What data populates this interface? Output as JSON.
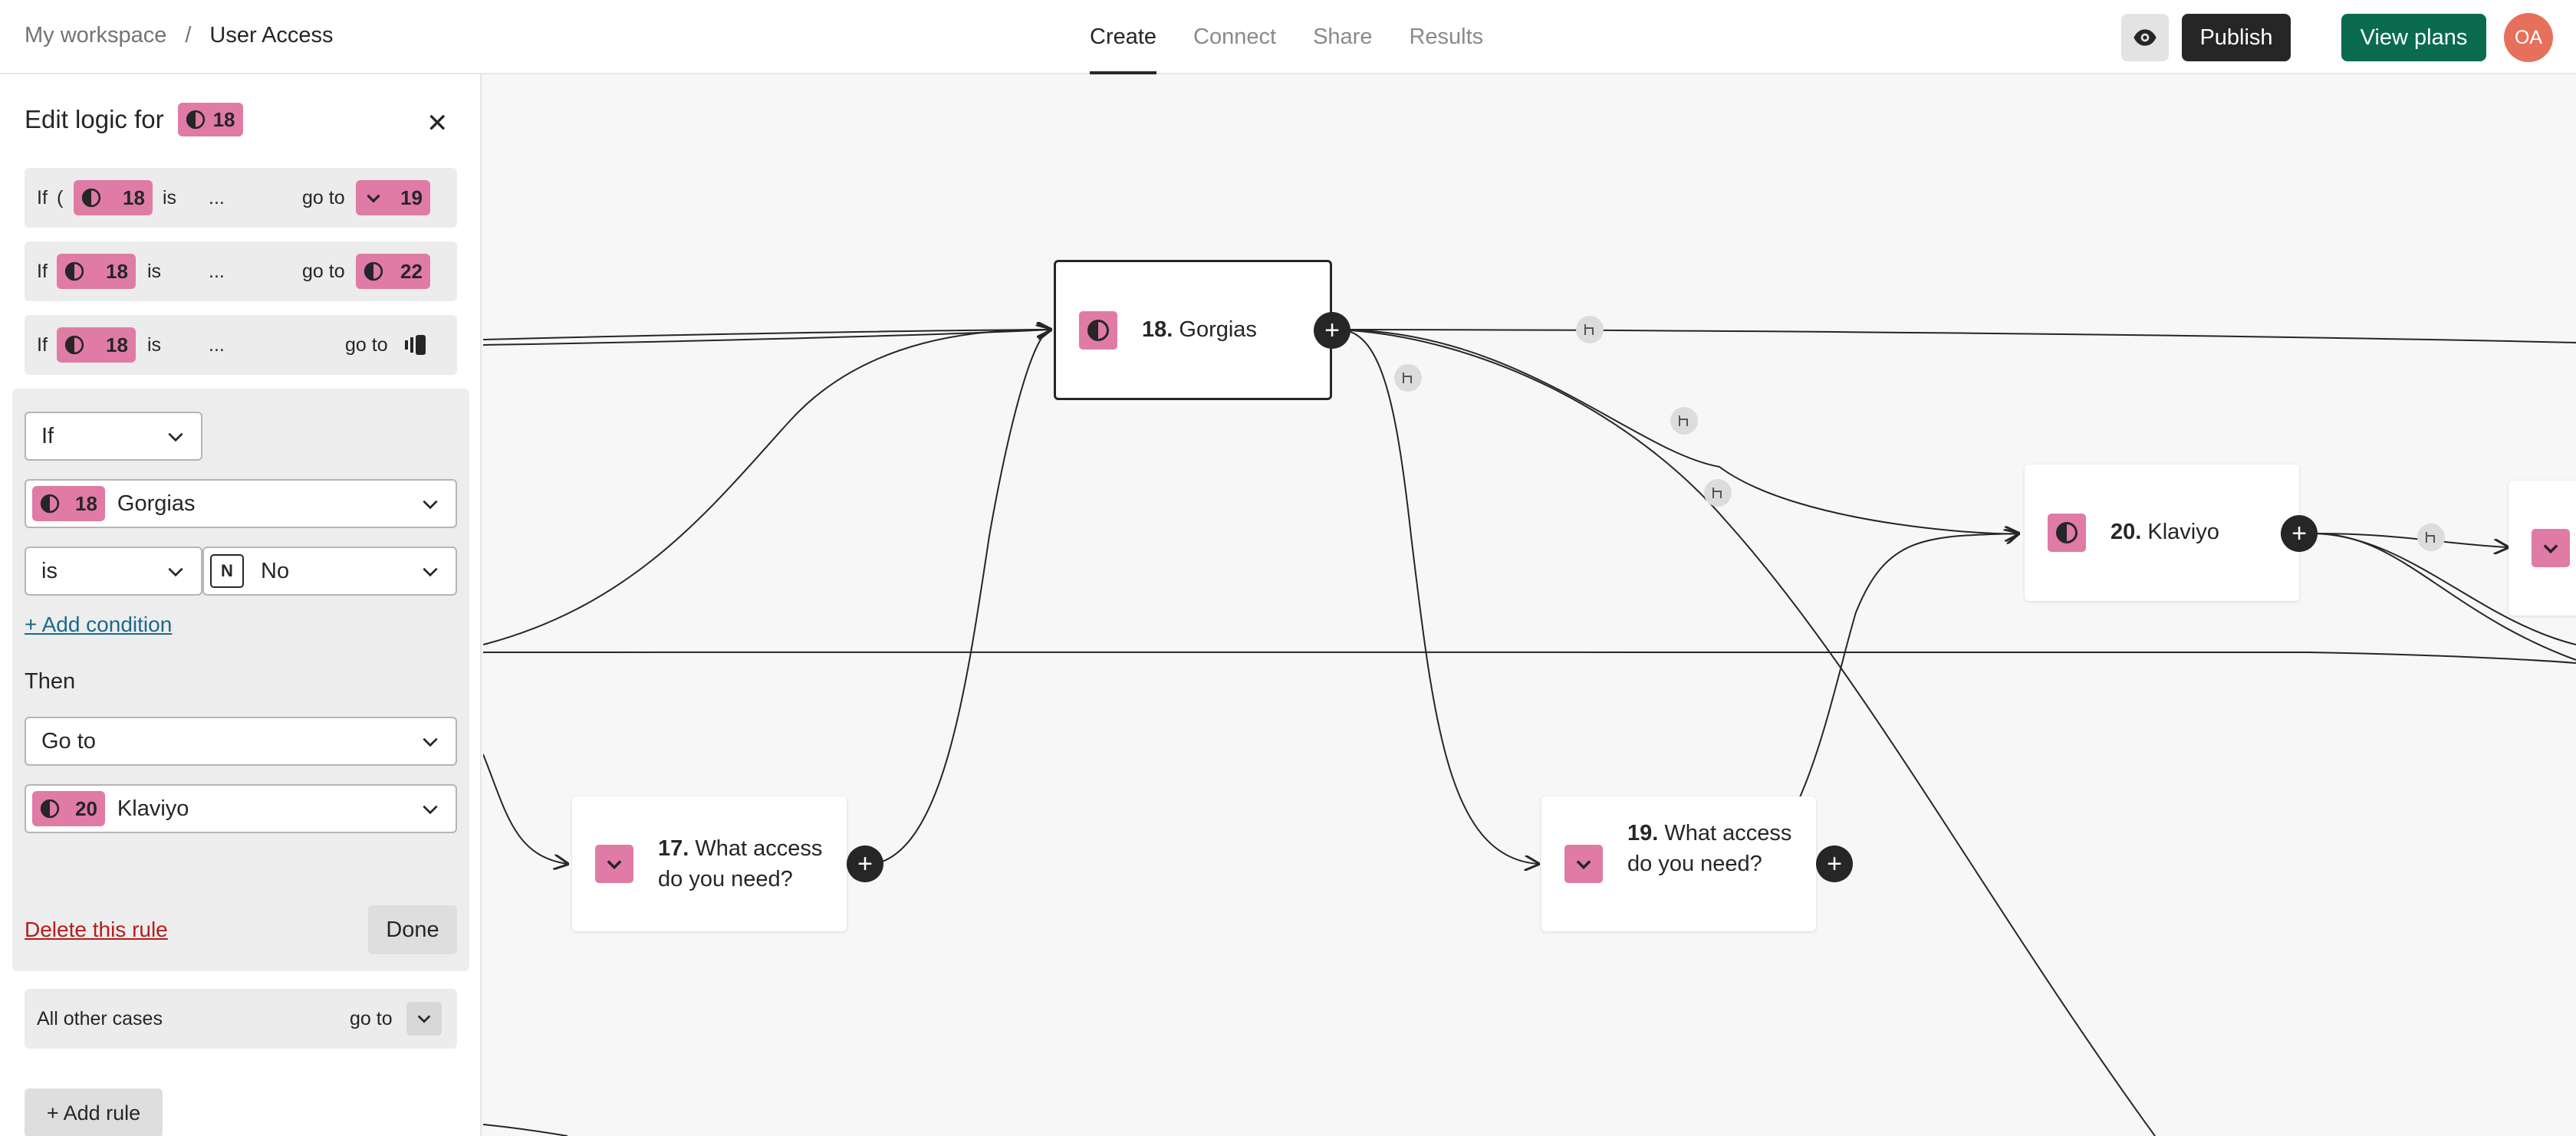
{
  "header": {
    "workspace": "My workspace",
    "separator": "/",
    "form_name": "User Access",
    "tabs": [
      {
        "label": "Create",
        "active": true
      },
      {
        "label": "Connect",
        "active": false
      },
      {
        "label": "Share",
        "active": false
      },
      {
        "label": "Results",
        "active": false
      }
    ],
    "preview_icon": "eye-icon",
    "publish_label": "Publish",
    "view_plans_label": "View plans",
    "avatar_initials": "OA"
  },
  "colors": {
    "accent_pink": "#e07ba6",
    "publish_bg": "#262627",
    "plans_bg": "#0b6b4f",
    "avatar_bg": "#e6705c",
    "delete_red": "#b51c1c"
  },
  "panel": {
    "title": "Edit logic for",
    "title_badge": "18",
    "close_icon": "close-icon",
    "rules": [
      {
        "if": "If",
        "paren": "(",
        "q": "18",
        "is": "is",
        "value": "...",
        "goto": "go to",
        "target": "19",
        "target_icon": "chevron-down-icon"
      },
      {
        "if": "If",
        "q": "18",
        "is": "is",
        "value": "...",
        "goto": "go to",
        "target": "22",
        "target_icon": "opinion-scale-icon"
      },
      {
        "if": "If",
        "q": "18",
        "is": "is",
        "value": "...",
        "goto": "go to",
        "target_icon": "end-screen-icon"
      }
    ],
    "editor": {
      "op": "If",
      "question_num": "18",
      "question_label": "Gorgias",
      "comparator": "is",
      "value_key": "N",
      "value_label": "No",
      "add_condition": "+ Add condition",
      "then_label": "Then",
      "action": "Go to",
      "target_num": "20",
      "target_label": "Klaviyo",
      "delete_label": "Delete this rule",
      "done_label": "Done"
    },
    "other": {
      "label": "All other cases",
      "goto": "go to"
    },
    "add_rule": "+ Add rule"
  },
  "canvas": {
    "nodes": [
      {
        "id": "n18",
        "num": "18.",
        "title": "Gorgias",
        "icon": "opinion-scale-icon",
        "selected": true
      },
      {
        "id": "n20",
        "num": "20.",
        "title": "Klaviyo",
        "icon": "opinion-scale-icon"
      },
      {
        "id": "n17",
        "num": "17.",
        "title": "What access do you need?",
        "icon": "chevron-down-icon"
      },
      {
        "id": "n19",
        "num": "19.",
        "title": "What access do you need?",
        "icon": "chevron-down-icon"
      }
    ],
    "branch_icon": "branch-icon",
    "add_icon": "plus-icon"
  }
}
